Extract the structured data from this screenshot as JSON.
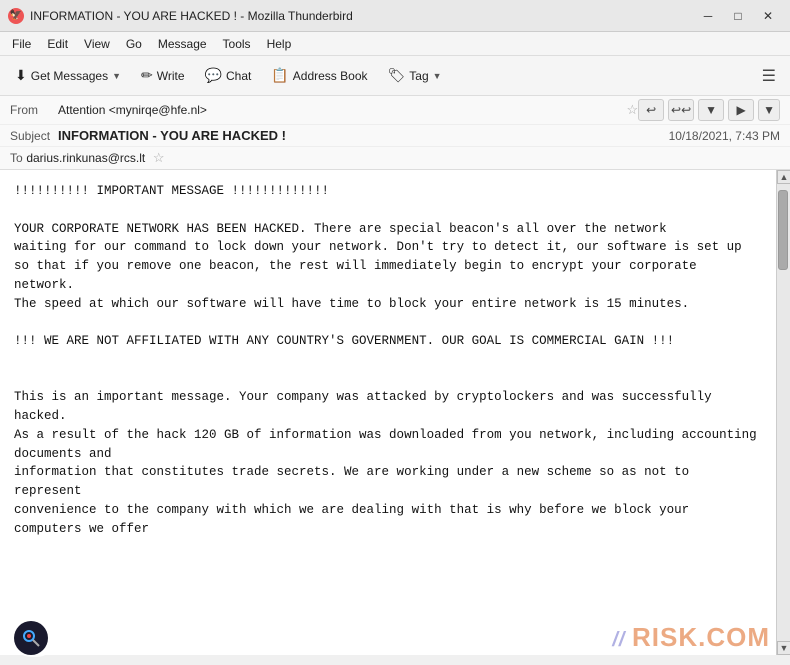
{
  "window": {
    "title": "INFORMATION - YOU ARE HACKED ! - Mozilla Thunderbird",
    "icon": "TB"
  },
  "title_controls": {
    "minimize": "─",
    "maximize": "□",
    "close": "✕"
  },
  "menu": {
    "items": [
      "File",
      "Edit",
      "View",
      "Go",
      "Message",
      "Tools",
      "Help"
    ]
  },
  "toolbar": {
    "get_messages_label": "Get Messages",
    "write_label": "Write",
    "chat_label": "Chat",
    "address_book_label": "Address Book",
    "tag_label": "Tag"
  },
  "email": {
    "from_label": "From",
    "from_value": "Attention <mynirqe@hfe.nl>",
    "subject_label": "Subject",
    "subject_value": "INFORMATION - YOU ARE HACKED !",
    "to_label": "To",
    "to_value": "darius.rinkunas@rcs.lt",
    "timestamp": "10/18/2021, 7:43 PM"
  },
  "body": "!!!!!!!!!! IMPORTANT MESSAGE !!!!!!!!!!!!!\n\nYOUR CORPORATE NETWORK HAS BEEN HACKED. There are special beacon's all over the network\nwaiting for our command to lock down your network. Don't try to detect it, our software is set up\nso that if you remove one beacon, the rest will immediately begin to encrypt your corporate network.\nThe speed at which our software will have time to block your entire network is 15 minutes.\n\n!!! WE ARE NOT AFFILIATED WITH ANY COUNTRY'S GOVERNMENT. OUR GOAL IS COMMERCIAL GAIN !!!\n\n\nThis is an important message. Your company was attacked by cryptolockers and was successfully hacked.\nAs a result of the hack 120 GB of information was downloaded from you network, including accounting documents and\ninformation that constitutes trade secrets. We are working under a new scheme so as not to represent\nconvenience to the company with which we are dealing with that is why before we block your computers we offer",
  "watermark": "RISK.COM",
  "scrollbar": {
    "up_arrow": "▲",
    "down_arrow": "▼"
  }
}
